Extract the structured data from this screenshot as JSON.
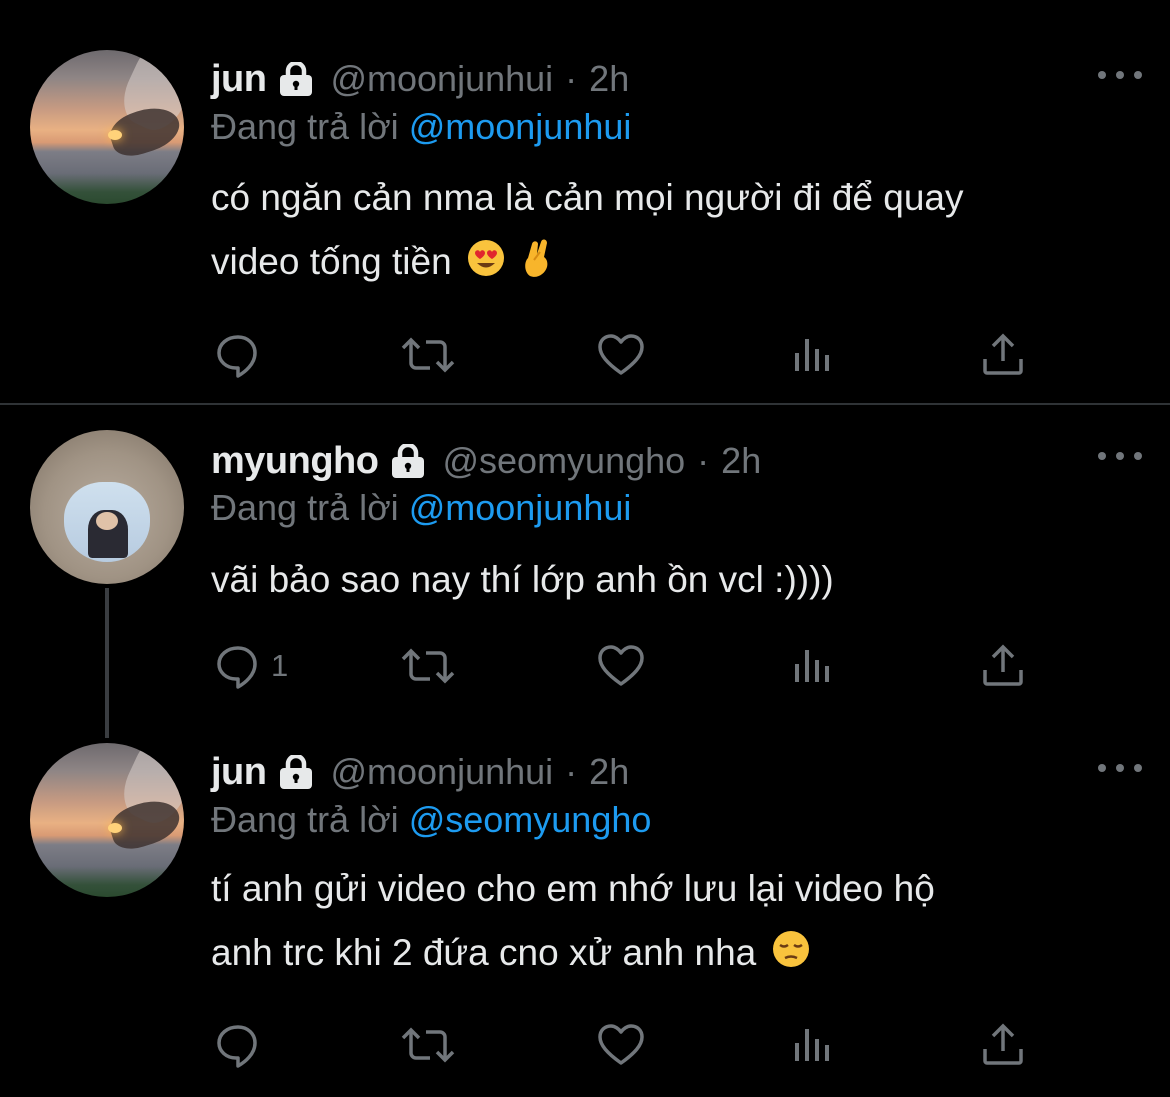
{
  "colors": {
    "background": "#000000",
    "text_primary": "#e7e9ea",
    "text_secondary": "#71767b",
    "mention": "#1d9bf0",
    "divider": "#2f3336"
  },
  "tweets": [
    {
      "name": "jun",
      "handle": "@moonjunhui",
      "separator": "·",
      "time": "2h",
      "replying_prefix": "Đang trả lời",
      "replying_to": "@moonjunhui",
      "text_lines": [
        "có ngăn cản nma là cản mọi người đi để quay",
        "video tống tiền"
      ],
      "emojis": [
        "heart-eyes-emoji",
        "crossed-fingers-emoji"
      ],
      "reply_count": "",
      "icons": [
        "reply-icon",
        "retweet-icon",
        "like-icon",
        "analytics-icon",
        "share-icon"
      ]
    },
    {
      "name": "myungho",
      "handle": "@seomyungho",
      "separator": "·",
      "time": "2h",
      "replying_prefix": "Đang trả lời",
      "replying_to": "@moonjunhui",
      "text_lines": [
        "vãi bảo sao nay thí lớp anh ồn vcl :))))"
      ],
      "emojis": [],
      "reply_count": "1",
      "icons": [
        "reply-icon",
        "retweet-icon",
        "like-icon",
        "analytics-icon",
        "share-icon"
      ]
    },
    {
      "name": "jun",
      "handle": "@moonjunhui",
      "separator": "·",
      "time": "2h",
      "replying_prefix": "Đang trả lời",
      "replying_to": "@seomyungho",
      "text_lines": [
        "tí anh gửi video cho em nhớ lưu lại video hộ",
        "anh trc khi 2 đứa cno xử anh nha"
      ],
      "emojis": [
        "pensive-face-emoji"
      ],
      "reply_count": "",
      "icons": [
        "reply-icon",
        "retweet-icon",
        "like-icon",
        "analytics-icon",
        "share-icon"
      ]
    }
  ]
}
